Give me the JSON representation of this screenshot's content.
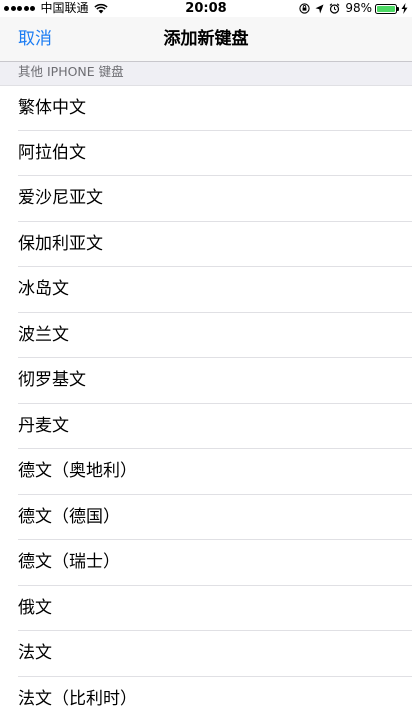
{
  "status_bar": {
    "carrier": "中国联通",
    "time": "20:08",
    "battery_percent": "98%",
    "battery_level": 0.98,
    "battery_color": "#4cd964"
  },
  "nav": {
    "cancel_label": "取消",
    "title": "添加新键盘",
    "accent_color": "#1b7cf3"
  },
  "section": {
    "header": "其他 IPHONE 键盘"
  },
  "keyboards": [
    "繁体中文",
    "阿拉伯文",
    "爱沙尼亚文",
    "保加利亚文",
    "冰岛文",
    "波兰文",
    "彻罗基文",
    "丹麦文",
    "德文（奥地利）",
    "德文（德国）",
    "德文（瑞士）",
    "俄文",
    "法文",
    "法文（比利时）"
  ],
  "icons": {
    "wifi": "wifi-icon",
    "orientation_lock": "orientation-lock-icon",
    "location": "location-arrow-icon",
    "alarm": "alarm-icon",
    "battery": "battery-icon",
    "charging": "charging-bolt-icon"
  }
}
